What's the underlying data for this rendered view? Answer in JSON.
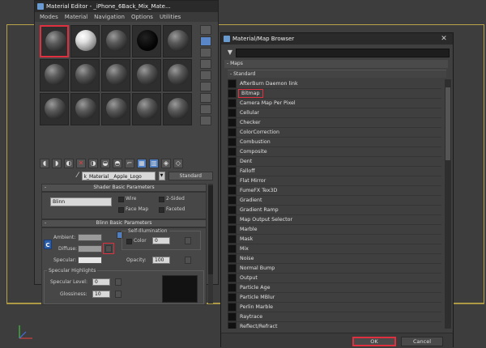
{
  "viewport": {
    "label": ""
  },
  "material_editor": {
    "title": "Material Editor - _iPhone_6Back_Mix_Mate...",
    "menu": [
      "Modes",
      "Material",
      "Navigation",
      "Options",
      "Utilities"
    ],
    "material_name": "k_Material__Apple_Logo",
    "material_type": "Standard",
    "shader_rollout": "Shader Basic Parameters",
    "shader_type": "Blinn",
    "wire": "Wire",
    "two_sided": "2-Sided",
    "face_map": "Face Map",
    "faceted": "Faceted",
    "blinn_rollout": "Blinn Basic Parameters",
    "self_illumination": "Self-Illumination",
    "color_label": "Color",
    "color_value": "0",
    "ambient": "Ambient:",
    "diffuse": "Diffuse:",
    "specular": "Specular:",
    "opacity_label": "Opacity:",
    "opacity_value": "100",
    "specular_highlights": "Specular Highlights",
    "specular_level_label": "Specular Level:",
    "specular_level_value": "0",
    "glossiness_label": "Glossiness:",
    "glossiness_value": "10",
    "c_lock": "C"
  },
  "browser": {
    "title": "Material/Map Browser",
    "section_maps": "- Maps",
    "section_standard": "- Standard",
    "items": [
      {
        "name": "AfterBurn Daemon link",
        "thumb": "black"
      },
      {
        "name": "Bitmap",
        "thumb": "black",
        "highlight": true
      },
      {
        "name": "Camera Map Per Pixel",
        "thumb": "black"
      },
      {
        "name": "Cellular",
        "thumb": "cellular"
      },
      {
        "name": "Checker",
        "thumb": "checker"
      },
      {
        "name": "ColorCorrection",
        "thumb": "black"
      },
      {
        "name": "Combustion",
        "thumb": "black"
      },
      {
        "name": "Composite",
        "thumb": "black"
      },
      {
        "name": "Dent",
        "thumb": "dent"
      },
      {
        "name": "Falloff",
        "thumb": "falloff"
      },
      {
        "name": "Flat Mirror",
        "thumb": "black"
      },
      {
        "name": "FumeFX Tex3D",
        "thumb": "black"
      },
      {
        "name": "Gradient",
        "thumb": "gradient"
      },
      {
        "name": "Gradient Ramp",
        "thumb": "gradramp"
      },
      {
        "name": "Map Output Selector",
        "thumb": "black"
      },
      {
        "name": "Marble",
        "thumb": "marble"
      },
      {
        "name": "Mask",
        "thumb": "white"
      },
      {
        "name": "Mix",
        "thumb": "black"
      },
      {
        "name": "Noise",
        "thumb": "noise"
      },
      {
        "name": "Normal Bump",
        "thumb": "normal"
      },
      {
        "name": "Output",
        "thumb": "white"
      },
      {
        "name": "Particle Age",
        "thumb": "black"
      },
      {
        "name": "Particle MBlur",
        "thumb": "black"
      },
      {
        "name": "Perlin Marble",
        "thumb": "perlin"
      },
      {
        "name": "Raytrace",
        "thumb": "black"
      },
      {
        "name": "Reflect/Refract",
        "thumb": "grey"
      }
    ],
    "ok": "OK",
    "cancel": "Cancel"
  },
  "colors": {
    "highlight": "#e03040",
    "accent": "#4e7fc4"
  }
}
